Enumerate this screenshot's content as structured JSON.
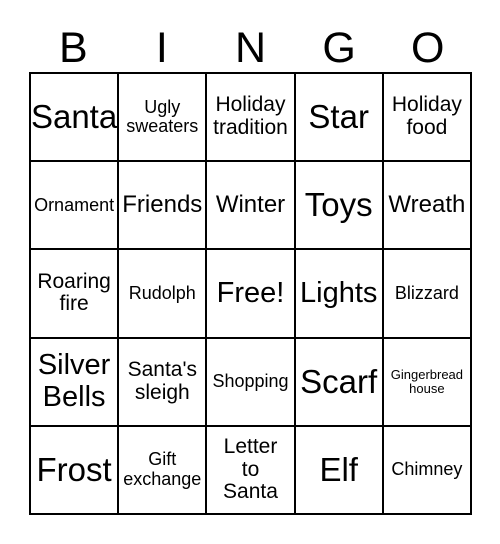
{
  "card": {
    "header": {
      "letters": [
        "B",
        "I",
        "N",
        "G",
        "O"
      ]
    },
    "colors": {
      "grid_line": "#000000",
      "text": "#000000",
      "background": "#ffffff"
    },
    "grid": {
      "columns": 5,
      "rows": 5,
      "cells": [
        {
          "text": "Santa",
          "size": "fs-xxl"
        },
        {
          "text": "Ugly\nsweaters",
          "size": "fs-s"
        },
        {
          "text": "Holiday\ntradition",
          "size": "fs-m"
        },
        {
          "text": "Star",
          "size": "fs-xxl"
        },
        {
          "text": "Holiday\nfood",
          "size": "fs-m"
        },
        {
          "text": "Ornament",
          "size": "fs-s"
        },
        {
          "text": "Friends",
          "size": "fs-l"
        },
        {
          "text": "Winter",
          "size": "fs-l"
        },
        {
          "text": "Toys",
          "size": "fs-xxl"
        },
        {
          "text": "Wreath",
          "size": "fs-l"
        },
        {
          "text": "Roaring\nfire",
          "size": "fs-m"
        },
        {
          "text": "Rudolph",
          "size": "fs-s"
        },
        {
          "text": "Free!",
          "size": "fs-xl"
        },
        {
          "text": "Lights",
          "size": "fs-xl"
        },
        {
          "text": "Blizzard",
          "size": "fs-s"
        },
        {
          "text": "Silver\nBells",
          "size": "fs-xl"
        },
        {
          "text": "Santa's\nsleigh",
          "size": "fs-m"
        },
        {
          "text": "Shopping",
          "size": "fs-s"
        },
        {
          "text": "Scarf",
          "size": "fs-xxl"
        },
        {
          "text": "Gingerbread\nhouse",
          "size": "fs-xxs"
        },
        {
          "text": "Frost",
          "size": "fs-xxl"
        },
        {
          "text": "Gift\nexchange",
          "size": "fs-s"
        },
        {
          "text": "Letter\nto\nSanta",
          "size": "fs-m"
        },
        {
          "text": "Elf",
          "size": "fs-xxl"
        },
        {
          "text": "Chimney",
          "size": "fs-s"
        }
      ]
    }
  }
}
